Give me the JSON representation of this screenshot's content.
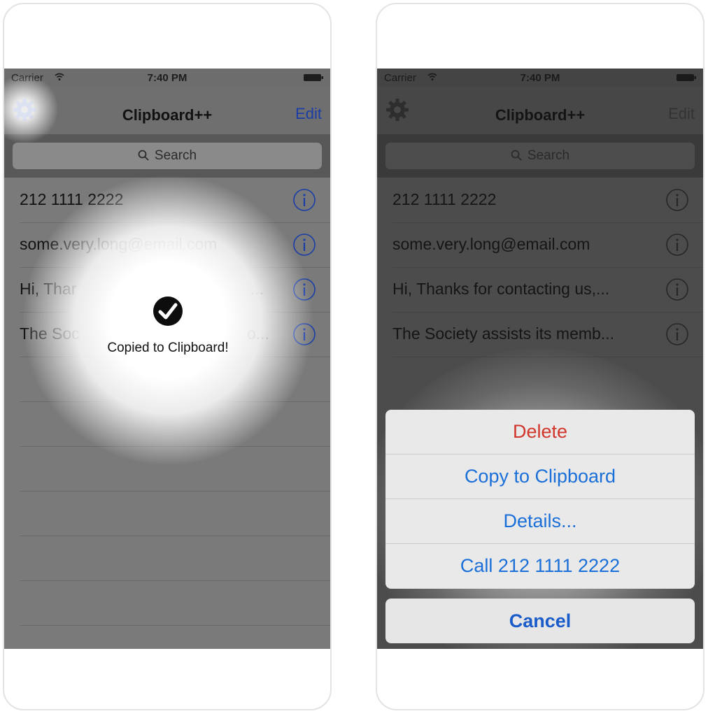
{
  "status_bar": {
    "carrier": "Carrier",
    "time": "7:40 PM"
  },
  "nav": {
    "title": "Clipboard++",
    "edit_label": "Edit"
  },
  "search": {
    "placeholder": "Search"
  },
  "clips": [
    {
      "text": "212 1111 2222"
    },
    {
      "text": "some.very.long@email.com"
    },
    {
      "text": "Hi, Thanks for contacting us,..."
    },
    {
      "text": "The Society assists its memb..."
    }
  ],
  "left_clips": [
    {
      "text": "212 1111 2222"
    },
    {
      "text": "some.very.long@email.com"
    },
    {
      "text": "Hi, Thar"
    },
    {
      "text": "The Soc"
    }
  ],
  "left_clip_tails": [
    "...",
    "o..."
  ],
  "toast": {
    "message": "Copied to Clipboard!"
  },
  "action_sheet": {
    "items": [
      {
        "label": "Delete"
      },
      {
        "label": "Copy to Clipboard"
      },
      {
        "label": "Details..."
      },
      {
        "label": "Call 212 1111 2222"
      }
    ],
    "cancel_label": "Cancel"
  },
  "colors": {
    "accent": "#1a3da6",
    "danger": "#d1352b",
    "link": "#1a6fd9"
  },
  "icons": [
    "wifi-icon",
    "battery-icon",
    "gear-icon",
    "search-icon",
    "info-icon",
    "check-icon"
  ]
}
